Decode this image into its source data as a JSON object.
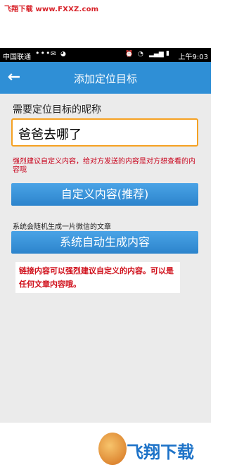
{
  "watermark": "飞翔下载 www.FXXZ.com",
  "status_bar": {
    "carrier": "中国联通",
    "dots": "•••",
    "time": "上午9:03"
  },
  "header": {
    "back_icon": "←",
    "title": "添加定位目标"
  },
  "form": {
    "nickname_label": "需要定位目标的昵称",
    "nickname_value": "爸爸去哪了",
    "custom_hint": "强烈建议自定义内容，给对方发送的内容是对方想查看的内容哦",
    "custom_button": "自定义内容(推荐)",
    "auto_hint": "系统会随机生成一片微信的文章",
    "auto_button": "系统自动生成内容"
  },
  "annotation": "链接内容可以强烈建议自定义的内容。可以是任何文章内容哦。",
  "footer_logo": "飞翔下载",
  "colors": {
    "accent": "#2f8fd6",
    "input_border": "#f5a122",
    "warning": "#c8001a"
  }
}
